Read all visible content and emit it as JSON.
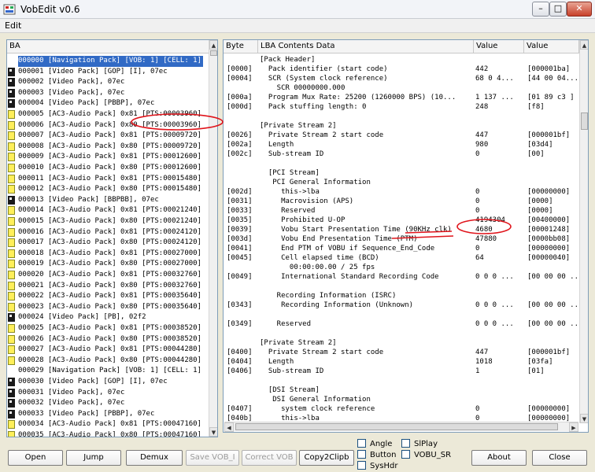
{
  "window": {
    "title": "VobEdit v0.6",
    "minimize_glyph": "–",
    "maximize_glyph": "□",
    "close_glyph": "✕"
  },
  "menu": {
    "edit": "Edit"
  },
  "left_panel": {
    "header": "BA",
    "rows": [
      {
        "icon": "none",
        "text": "000000 [Navigation Pack] [VOB: 1] [CELL: 1]"
      },
      {
        "icon": "video",
        "text": "000001 [Video Pack] [GOP] [I], 07ec"
      },
      {
        "icon": "video",
        "text": "000002 [Video Pack], 07ec"
      },
      {
        "icon": "video",
        "text": "000003 [Video Pack], 07ec"
      },
      {
        "icon": "video",
        "text": "000004 [Video Pack] [PBBP], 07ec"
      },
      {
        "icon": "audio",
        "text": "000005 [AC3-Audio Pack] 0x81 [PTS:00003960]"
      },
      {
        "icon": "audio",
        "text": "000006 [AC3-Audio Pack] 0x80 [PTS:00003960]"
      },
      {
        "icon": "audio",
        "text": "000007 [AC3-Audio Pack] 0x81 [PTS:00009720]"
      },
      {
        "icon": "audio",
        "text": "000008 [AC3-Audio Pack] 0x80 [PTS:00009720]"
      },
      {
        "icon": "audio",
        "text": "000009 [AC3-Audio Pack] 0x81 [PTS:00012600]"
      },
      {
        "icon": "audio",
        "text": "000010 [AC3-Audio Pack] 0x80 [PTS:00012600]"
      },
      {
        "icon": "audio",
        "text": "000011 [AC3-Audio Pack] 0x81 [PTS:00015480]"
      },
      {
        "icon": "audio",
        "text": "000012 [AC3-Audio Pack] 0x80 [PTS:00015480]"
      },
      {
        "icon": "video",
        "text": "000013 [Video Pack] [BBPBB], 07ec"
      },
      {
        "icon": "audio",
        "text": "000014 [AC3-Audio Pack] 0x81 [PTS:00021240]"
      },
      {
        "icon": "audio",
        "text": "000015 [AC3-Audio Pack] 0x80 [PTS:00021240]"
      },
      {
        "icon": "audio",
        "text": "000016 [AC3-Audio Pack] 0x81 [PTS:00024120]"
      },
      {
        "icon": "audio",
        "text": "000017 [AC3-Audio Pack] 0x80 [PTS:00024120]"
      },
      {
        "icon": "audio",
        "text": "000018 [AC3-Audio Pack] 0x81 [PTS:00027000]"
      },
      {
        "icon": "audio",
        "text": "000019 [AC3-Audio Pack] 0x80 [PTS:00027000]"
      },
      {
        "icon": "audio",
        "text": "000020 [AC3-Audio Pack] 0x81 [PTS:00032760]"
      },
      {
        "icon": "audio",
        "text": "000021 [AC3-Audio Pack] 0x80 [PTS:00032760]"
      },
      {
        "icon": "audio",
        "text": "000022 [AC3-Audio Pack] 0x81 [PTS:00035640]"
      },
      {
        "icon": "audio",
        "text": "000023 [AC3-Audio Pack] 0x80 [PTS:00035640]"
      },
      {
        "icon": "video",
        "text": "000024 [Video Pack] [PB], 02f2"
      },
      {
        "icon": "audio",
        "text": "000025 [AC3-Audio Pack] 0x81 [PTS:00038520]"
      },
      {
        "icon": "audio",
        "text": "000026 [AC3-Audio Pack] 0x80 [PTS:00038520]"
      },
      {
        "icon": "audio",
        "text": "000027 [AC3-Audio Pack] 0x81 [PTS:00044280]"
      },
      {
        "icon": "audio",
        "text": "000028 [AC3-Audio Pack] 0x80 [PTS:00044280]"
      },
      {
        "icon": "none",
        "text": "000029 [Navigation Pack] [VOB: 1] [CELL: 1]"
      },
      {
        "icon": "video",
        "text": "000030 [Video Pack] [GOP] [I], 07ec"
      },
      {
        "icon": "video",
        "text": "000031 [Video Pack], 07ec"
      },
      {
        "icon": "video",
        "text": "000032 [Video Pack], 07ec"
      },
      {
        "icon": "video",
        "text": "000033 [Video Pack] [PBBP], 07ec"
      },
      {
        "icon": "audio",
        "text": "000034 [AC3-Audio Pack] 0x81 [PTS:00047160]"
      },
      {
        "icon": "audio",
        "text": "000035 [AC3-Audio Pack] 0x80 [PTS:00047160]"
      }
    ]
  },
  "right_panel": {
    "headers": {
      "byte": "Byte",
      "contents": "LBA Contents Data",
      "value": "Value",
      "value2": "Value"
    },
    "rows": [
      {
        "byte": "",
        "desc": "[Pack Header]",
        "value": "",
        "value2": ""
      },
      {
        "byte": "[0000]",
        "desc": "  Pack identifier (start code)",
        "value": "442",
        "value2": "[000001ba]"
      },
      {
        "byte": "[0004]",
        "desc": "  SCR (System clock reference)",
        "value": "68 0 4...",
        "value2": "[44 00 04..."
      },
      {
        "byte": "",
        "desc": "    SCR 00000000.000",
        "value": "",
        "value2": ""
      },
      {
        "byte": "[000a]",
        "desc": "  Program Mux Rate: 25200 (1260000 BPS) (10...",
        "value": "1 137 ...",
        "value2": "[01 89 c3 ]"
      },
      {
        "byte": "[000d]",
        "desc": "  Pack stuffing length: 0",
        "value": "248",
        "value2": "[f8]"
      },
      {
        "byte": "",
        "desc": "",
        "value": "",
        "value2": ""
      },
      {
        "byte": "",
        "desc": "[Private Stream 2]",
        "value": "",
        "value2": ""
      },
      {
        "byte": "[0026]",
        "desc": "  Private Stream 2 start code",
        "value": "447",
        "value2": "[000001bf]"
      },
      {
        "byte": "[002a]",
        "desc": "  Length",
        "value": "980",
        "value2": "[03d4]"
      },
      {
        "byte": "[002c]",
        "desc": "  Sub-stream ID",
        "value": "0",
        "value2": "[00]"
      },
      {
        "byte": "",
        "desc": "",
        "value": "",
        "value2": ""
      },
      {
        "byte": "",
        "desc": "  [PCI Stream]",
        "value": "",
        "value2": ""
      },
      {
        "byte": "",
        "desc": "   PCI General Information",
        "value": "",
        "value2": ""
      },
      {
        "byte": "[002d]",
        "desc": "     this->lba",
        "value": "0",
        "value2": "[00000000]"
      },
      {
        "byte": "[0031]",
        "desc": "     Macrovision (APS)",
        "value": "0",
        "value2": "[0000]"
      },
      {
        "byte": "[0033]",
        "desc": "     Reserved",
        "value": "0",
        "value2": "[0000]"
      },
      {
        "byte": "[0035]",
        "desc": "     Prohibited U-OP",
        "value": "4194304",
        "value2": "[00400000]"
      },
      {
        "byte": "[0039]",
        "desc": "     Vobu Start Presentation Time (90KHz clk)",
        "value": "4680",
        "value2": "[00001248]"
      },
      {
        "byte": "[003d]",
        "desc": "     Vobu End Presentation Time (PTM)",
        "value": "47880",
        "value2": "[0000bb08]"
      },
      {
        "byte": "[0041]",
        "desc": "     End PTM of VOBU if Sequence_End_Code",
        "value": "0",
        "value2": "[00000000]"
      },
      {
        "byte": "[0045]",
        "desc": "     Cell elapsed time (BCD)",
        "value": "64",
        "value2": "[00000040]"
      },
      {
        "byte": "",
        "desc": "       00:00:00.00 / 25 fps",
        "value": "",
        "value2": ""
      },
      {
        "byte": "[0049]",
        "desc": "     International Standard Recording Code",
        "value": "0 0 0 ...",
        "value2": "[00 00 00 ..."
      },
      {
        "byte": "",
        "desc": "",
        "value": "",
        "value2": ""
      },
      {
        "byte": "",
        "desc": "    Recording Information (ISRC)",
        "value": "",
        "value2": ""
      },
      {
        "byte": "[0343]",
        "desc": "     Recording Information (Unknown)",
        "value": "0 0 0 ...",
        "value2": "[00 00 00 ..."
      },
      {
        "byte": "",
        "desc": "",
        "value": "",
        "value2": ""
      },
      {
        "byte": "[0349]",
        "desc": "    Reserved",
        "value": "0 0 0 ...",
        "value2": "[00 00 00 ..."
      },
      {
        "byte": "",
        "desc": "",
        "value": "",
        "value2": ""
      },
      {
        "byte": "",
        "desc": "[Private Stream 2]",
        "value": "",
        "value2": ""
      },
      {
        "byte": "[0400]",
        "desc": "  Private Stream 2 start code",
        "value": "447",
        "value2": "[000001bf]"
      },
      {
        "byte": "[0404]",
        "desc": "  Length",
        "value": "1018",
        "value2": "[03fa]"
      },
      {
        "byte": "[0406]",
        "desc": "  Sub-stream ID",
        "value": "1",
        "value2": "[01]"
      },
      {
        "byte": "",
        "desc": "",
        "value": "",
        "value2": ""
      },
      {
        "byte": "",
        "desc": "  [DSI Stream]",
        "value": "",
        "value2": ""
      },
      {
        "byte": "",
        "desc": "   DSI General Information",
        "value": "",
        "value2": ""
      },
      {
        "byte": "[0407]",
        "desc": "     system clock reference",
        "value": "0",
        "value2": "[00000000]"
      },
      {
        "byte": "[040b]",
        "desc": "     this->lba",
        "value": "0",
        "value2": "[00000000]"
      }
    ]
  },
  "buttons": {
    "open": "Open",
    "jump": "Jump",
    "demux": "Demux",
    "save_vob": "Save VOB_I",
    "correct_vob": "Correct VOB",
    "copy2clipb": "Copy2Clipb",
    "about": "About",
    "close": "Close"
  },
  "checkboxes": {
    "angle": "Angle",
    "button": "Button",
    "syshdr": "SysHdr",
    "s1play": "SlPlay",
    "vobu_sr": "VOBU_SR"
  },
  "colors": {
    "selection": "#316ac5",
    "annotation_red": "#e0141b",
    "audio_icon": "#ffef5a",
    "video_icon": "#1a1a1a"
  }
}
